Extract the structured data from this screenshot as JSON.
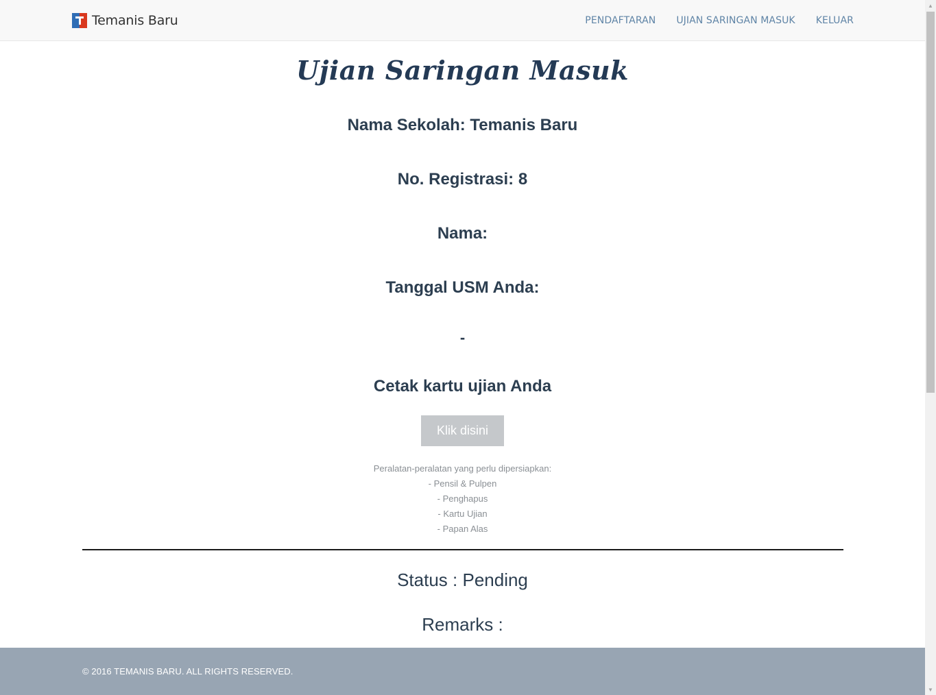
{
  "navbar": {
    "brand": "Temanis Baru",
    "links": [
      "PENDAFTARAN",
      "UJIAN SARINGAN MASUK",
      "KELUAR"
    ]
  },
  "main": {
    "title": "Ujian Saringan Masuk",
    "nama_sekolah": "Nama Sekolah: Temanis Baru",
    "no_registrasi": "No. Registrasi: 8",
    "nama": "Nama:",
    "tanggal_usm": "Tanggal USM Anda:",
    "tanggal_value": "-",
    "cetak_label": "Cetak kartu ujian Anda",
    "button_label": "Klik disini",
    "equipment": [
      "Peralatan-peralatan yang perlu dipersiapkan:",
      "- Pensil & Pulpen",
      "- Penghapus",
      "- Kartu Ujian",
      "- Papan Alas"
    ],
    "status": "Status : Pending",
    "remarks": "Remarks :"
  },
  "footer": {
    "copyright": "© 2016 TEMANIS BARU. ALL RIGHTS RESERVED."
  },
  "colors": {
    "nav_link": "#5f84a6",
    "heading": "#2c3e50",
    "button_disabled": "#c5c8cb",
    "footer_bg": "#98a5b3"
  }
}
